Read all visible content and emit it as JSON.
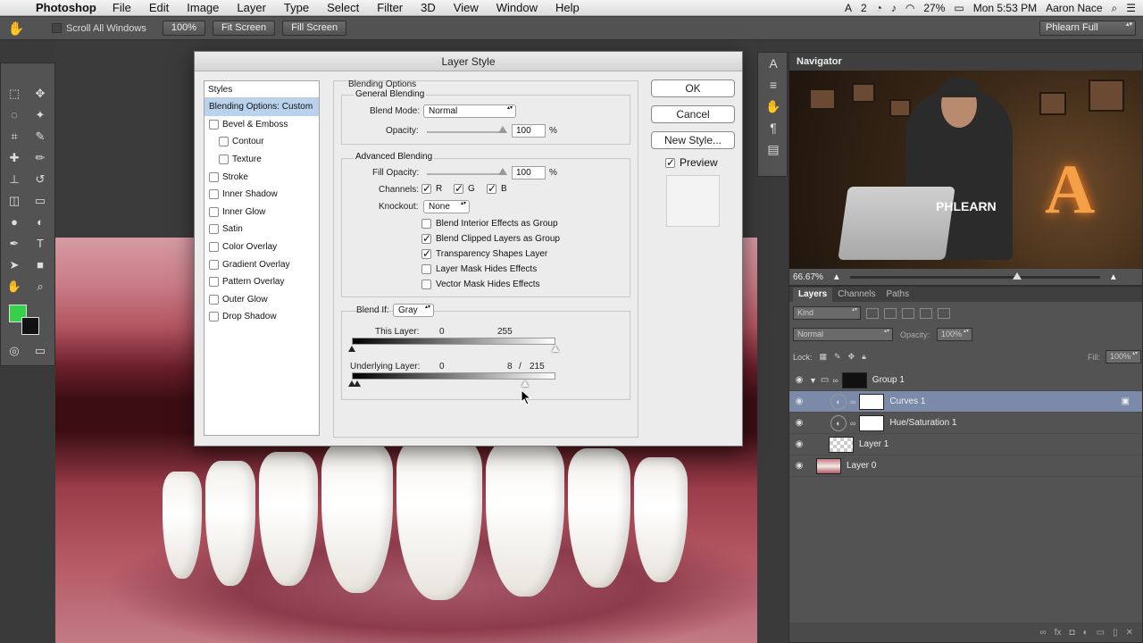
{
  "menubar": {
    "app_name": "Photoshop",
    "items": [
      "File",
      "Edit",
      "Image",
      "Layer",
      "Type",
      "Select",
      "Filter",
      "3D",
      "View",
      "Window",
      "Help"
    ],
    "status": {
      "battery": "27%",
      "clock": "Mon 5:53 PM",
      "user": "Aaron Nace",
      "badge": "2"
    }
  },
  "options_bar": {
    "scroll_all": "Scroll All Windows",
    "zoom_100": "100%",
    "fit_screen": "Fit Screen",
    "fill_screen": "Fill Screen",
    "workspace": "Phlearn Full"
  },
  "toolbox": {
    "foreground_color": "#35d14a",
    "background_color": "#111111"
  },
  "dialog": {
    "title": "Layer Style",
    "styles_header": "Styles",
    "styles": [
      {
        "label": "Blending Options: Custom",
        "checkbox": false,
        "sub": false,
        "active": true
      },
      {
        "label": "Bevel & Emboss",
        "checkbox": true,
        "sub": false,
        "active": false
      },
      {
        "label": "Contour",
        "checkbox": true,
        "sub": true,
        "active": false
      },
      {
        "label": "Texture",
        "checkbox": true,
        "sub": true,
        "active": false
      },
      {
        "label": "Stroke",
        "checkbox": true,
        "sub": false,
        "active": false
      },
      {
        "label": "Inner Shadow",
        "checkbox": true,
        "sub": false,
        "active": false
      },
      {
        "label": "Inner Glow",
        "checkbox": true,
        "sub": false,
        "active": false
      },
      {
        "label": "Satin",
        "checkbox": true,
        "sub": false,
        "active": false
      },
      {
        "label": "Color Overlay",
        "checkbox": true,
        "sub": false,
        "active": false
      },
      {
        "label": "Gradient Overlay",
        "checkbox": true,
        "sub": false,
        "active": false
      },
      {
        "label": "Pattern Overlay",
        "checkbox": true,
        "sub": false,
        "active": false
      },
      {
        "label": "Outer Glow",
        "checkbox": true,
        "sub": false,
        "active": false
      },
      {
        "label": "Drop Shadow",
        "checkbox": true,
        "sub": false,
        "active": false
      }
    ],
    "blending_options": "Blending Options",
    "general_blending": "General Blending",
    "blend_mode_label": "Blend Mode:",
    "blend_mode_value": "Normal",
    "opacity_label": "Opacity:",
    "opacity_value": "100",
    "percent": "%",
    "advanced_blending": "Advanced Blending",
    "fill_opacity_label": "Fill Opacity:",
    "fill_opacity_value": "100",
    "channels_label": "Channels:",
    "channels": [
      {
        "label": "R",
        "checked": true
      },
      {
        "label": "G",
        "checked": true
      },
      {
        "label": "B",
        "checked": true
      }
    ],
    "knockout_label": "Knockout:",
    "knockout_value": "None",
    "advanced_checks": [
      {
        "label": "Blend Interior Effects as Group",
        "checked": false
      },
      {
        "label": "Blend Clipped Layers as Group",
        "checked": true
      },
      {
        "label": "Transparency Shapes Layer",
        "checked": true
      },
      {
        "label": "Layer Mask Hides Effects",
        "checked": false
      },
      {
        "label": "Vector Mask Hides Effects",
        "checked": false
      }
    ],
    "blend_if_label": "Blend If:",
    "blend_if_value": "Gray",
    "this_layer_label": "This Layer:",
    "this_layer_low": "0",
    "this_layer_high": "255",
    "underlying_label": "Underlying Layer:",
    "underlying_low": "0",
    "underlying_split": "8",
    "underlying_sep": "/",
    "underlying_high": "215",
    "ok": "OK",
    "cancel": "Cancel",
    "new_style": "New Style...",
    "preview": "Preview",
    "preview_checked": true
  },
  "navigator": {
    "title": "Navigator",
    "zoom": "66.67%",
    "zoom_fraction": 0.6667,
    "shirt_text": "PHLEARN",
    "sign_letter": "A"
  },
  "layers_panel": {
    "tabs": [
      "Layers",
      "Channels",
      "Paths"
    ],
    "kind": "Kind",
    "blend_mode": "Normal",
    "opacity_label": "Opacity:",
    "opacity_value": "100%",
    "lock_label": "Lock:",
    "fill_label": "Fill:",
    "fill_value": "100%",
    "layers": [
      {
        "name": "Group 1",
        "type": "group",
        "selected": false
      },
      {
        "name": "Curves 1",
        "type": "adjustment",
        "selected": true
      },
      {
        "name": "Hue/Saturation 1",
        "type": "adjustment",
        "selected": false
      },
      {
        "name": "Layer 1",
        "type": "checker",
        "selected": false
      },
      {
        "name": "Layer 0",
        "type": "photo",
        "selected": false
      }
    ]
  }
}
